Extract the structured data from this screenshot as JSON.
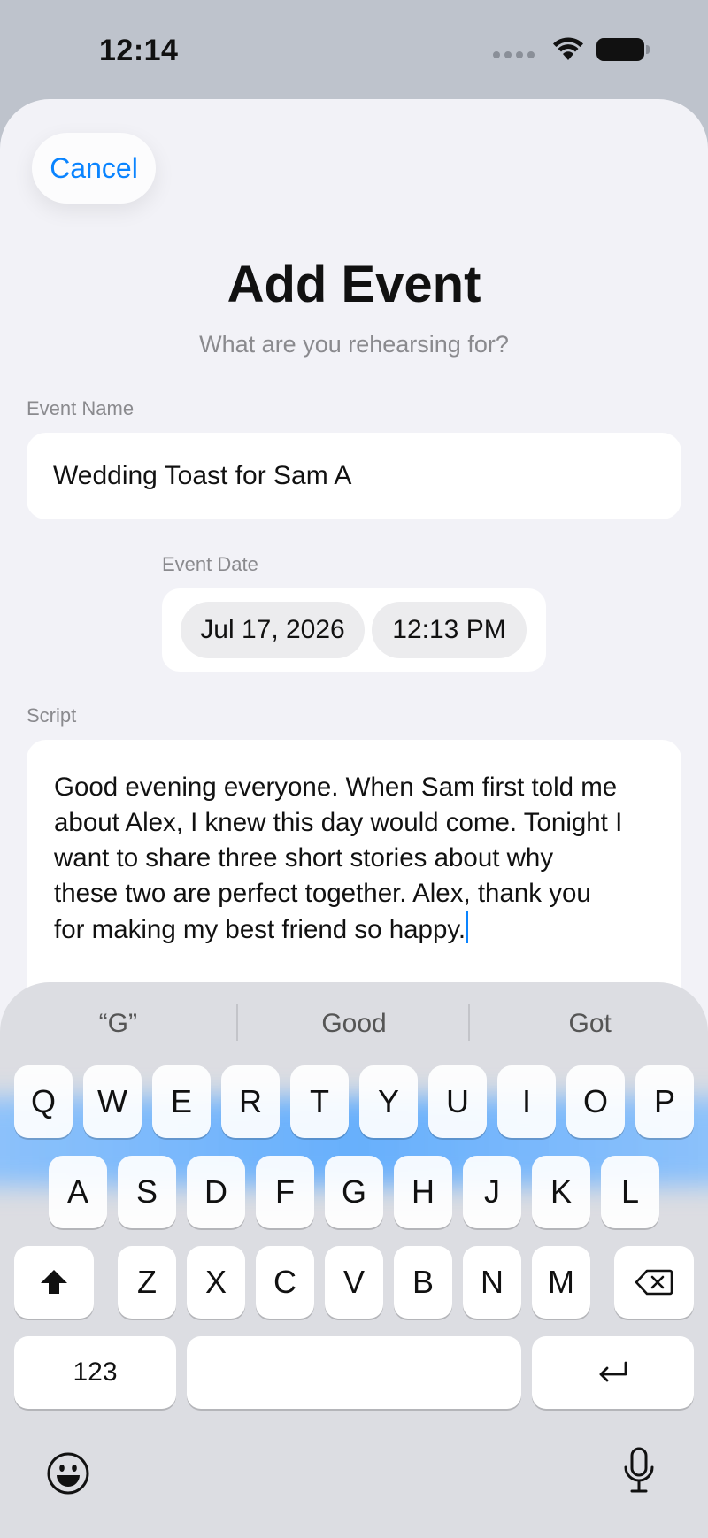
{
  "status_bar": {
    "time": "12:14"
  },
  "sheet": {
    "cancel_label": "Cancel",
    "title": "Add Event",
    "subtitle": "What are you rehearsing for?",
    "event_name": {
      "label": "Event Name",
      "value": "Wedding Toast for Sam A"
    },
    "event_date": {
      "label": "Event Date",
      "date": "Jul 17, 2026",
      "time": "12:13 PM"
    },
    "script": {
      "label": "Script",
      "lines": [
        "Good evening everyone. When Sam first told me",
        "about Alex, I knew this day would come. Tonight I",
        "want to share three short stories about why",
        "these two are perfect together. Alex, thank you",
        "for making my best friend so happy."
      ]
    }
  },
  "keyboard": {
    "suggestions": [
      "“G”",
      "Good",
      "Got"
    ],
    "row1": [
      "Q",
      "W",
      "E",
      "R",
      "T",
      "Y",
      "U",
      "I",
      "O",
      "P"
    ],
    "row2": [
      "A",
      "S",
      "D",
      "F",
      "G",
      "H",
      "J",
      "K",
      "L"
    ],
    "row3": [
      "Z",
      "X",
      "C",
      "V",
      "B",
      "N",
      "M"
    ],
    "numbers_label": "123",
    "icons": {
      "shift": "shift-icon",
      "delete": "delete-icon",
      "return": "return-icon",
      "emoji": "emoji-icon",
      "mic": "microphone-icon"
    }
  }
}
